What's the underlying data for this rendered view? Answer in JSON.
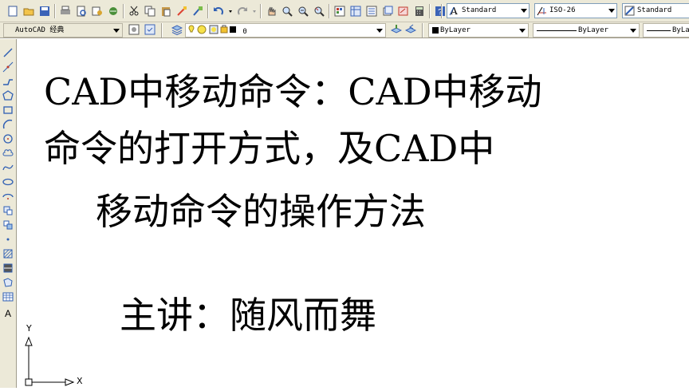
{
  "toolbar_standard": {
    "text_style": "Standard",
    "dim_style": "ISO-26",
    "table_style": "Standard"
  },
  "toolbar_layers": {
    "workspace": "AutoCAD 经典",
    "layer": "0",
    "color": "ByLayer",
    "linetype": "ByLayer",
    "lineweight": "ByLa"
  },
  "drawing": {
    "title_line1": "CAD中移动命令：CAD中移动",
    "title_line2": "命令的打开方式，及CAD中",
    "title_line3": "移动命令的操作方法",
    "presenter": "主讲：随风而舞"
  },
  "ucs": {
    "x_label": "X",
    "y_label": "Y"
  },
  "colors": {
    "toolbar_bg": "#ece9d8",
    "canvas_bg": "#ffffff",
    "icon_blue": "#2f5fb3",
    "icon_red": "#c0392b"
  },
  "icons": [
    "new-icon",
    "open-icon",
    "save-icon",
    "print-icon",
    "preview-icon",
    "publish-icon",
    "plot-icon",
    "cut-icon",
    "copy-icon",
    "paste-icon",
    "match-icon",
    "block-icon",
    "undo-icon",
    "redo-icon",
    "pan-icon",
    "zoom-icon",
    "zoom-window-icon",
    "zoom-prev-icon",
    "properties-icon",
    "design-center-icon",
    "tool-palettes-icon",
    "sheet-set-icon",
    "markup-icon",
    "calculator-icon",
    "help-icon"
  ]
}
